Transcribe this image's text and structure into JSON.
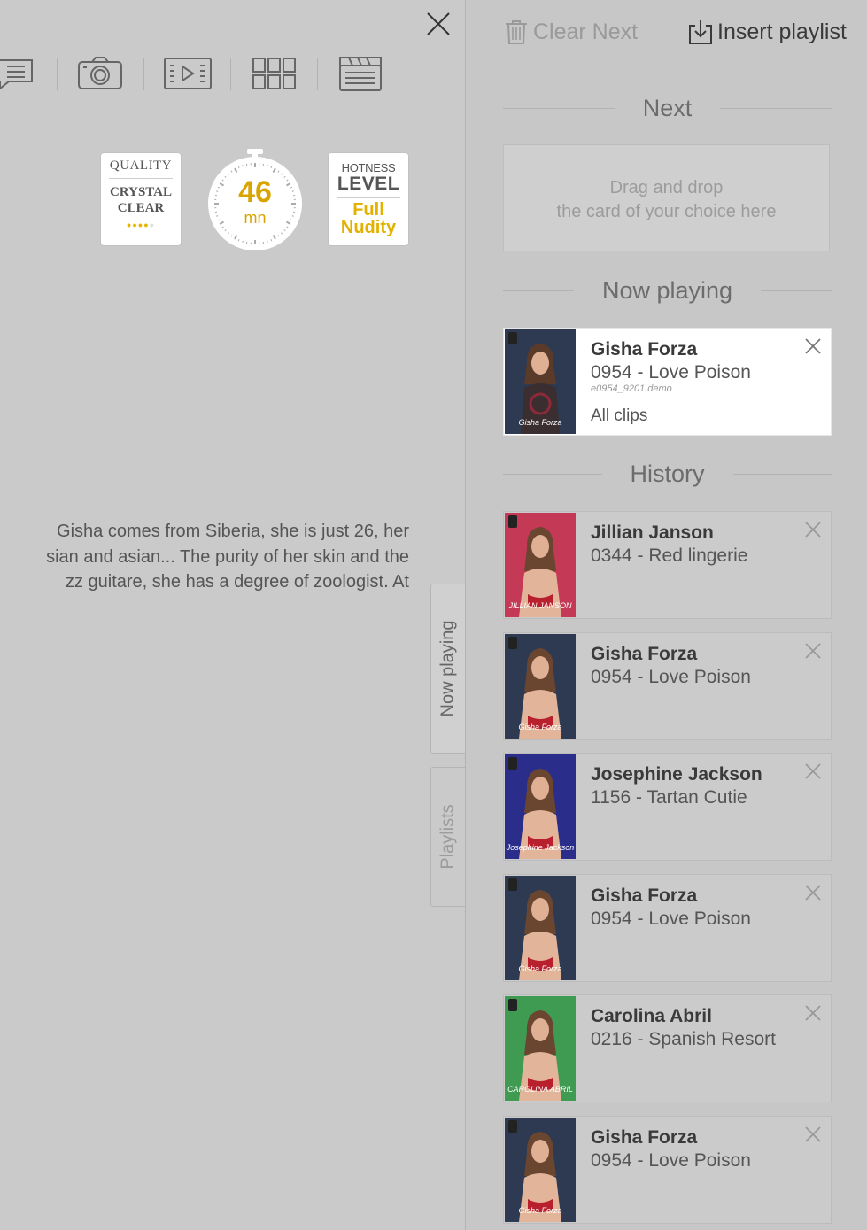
{
  "left": {
    "badges": {
      "quality": {
        "line1": "QUALITY",
        "line2": "CRYSTAL",
        "line3": "CLEAR",
        "stars": 4,
        "stars_total": 5
      },
      "duration": {
        "value": "46",
        "unit": "mn"
      },
      "hotness": {
        "line1": "HOTNESS",
        "line2": "LEVEL",
        "line3": "Full",
        "line4": "Nudity"
      }
    },
    "description": [
      "Gisha comes from Siberia, she is just 26, her",
      "sian and asian... The purity of her skin and the",
      "zz guitare, she has a degree of zoologist. At"
    ],
    "tabs": {
      "now_playing": "Now playing",
      "playlists": "Playlists"
    }
  },
  "right": {
    "clear_next_label": "Clear Next",
    "insert_playlist_label": "Insert playlist",
    "next_heading": "Next",
    "dropzone_line1": "Drag and drop",
    "dropzone_line2": "the card of your choice here",
    "now_playing_heading": "Now playing",
    "now_playing": {
      "name": "Gisha Forza",
      "title": "0954 - Love Poison",
      "code": "e0954_9201.demo",
      "clips": "All clips",
      "thumb_caption": "Gisha Forza"
    },
    "history_heading": "History",
    "history": [
      {
        "name": "Jillian Janson",
        "title": "0344 - Red lingerie",
        "thumb_caption": "JILLIAN JANSON",
        "thumb_color": "#c43a56"
      },
      {
        "name": "Gisha Forza",
        "title": "0954 - Love Poison",
        "thumb_caption": "Gisha Forza",
        "thumb_color": "#2d3a52"
      },
      {
        "name": "Josephine Jackson",
        "title": "1156 - Tartan Cutie",
        "thumb_caption": "Josephine Jackson",
        "thumb_color": "#2a2e8a"
      },
      {
        "name": "Gisha Forza",
        "title": "0954 - Love Poison",
        "thumb_caption": "Gisha Forza",
        "thumb_color": "#2d3a52"
      },
      {
        "name": "Carolina Abril",
        "title": "0216 - Spanish Resort",
        "thumb_caption": "CAROLINA ABRIL",
        "thumb_color": "#3f9a52"
      },
      {
        "name": "Gisha Forza",
        "title": "0954 - Love Poison",
        "thumb_caption": "Gisha Forza",
        "thumb_color": "#2d3a52"
      }
    ]
  },
  "colors": {
    "accent_gold": "#d8a400",
    "panel_bg": "#c7c7c7",
    "active_card_bg": "#ffffff"
  }
}
